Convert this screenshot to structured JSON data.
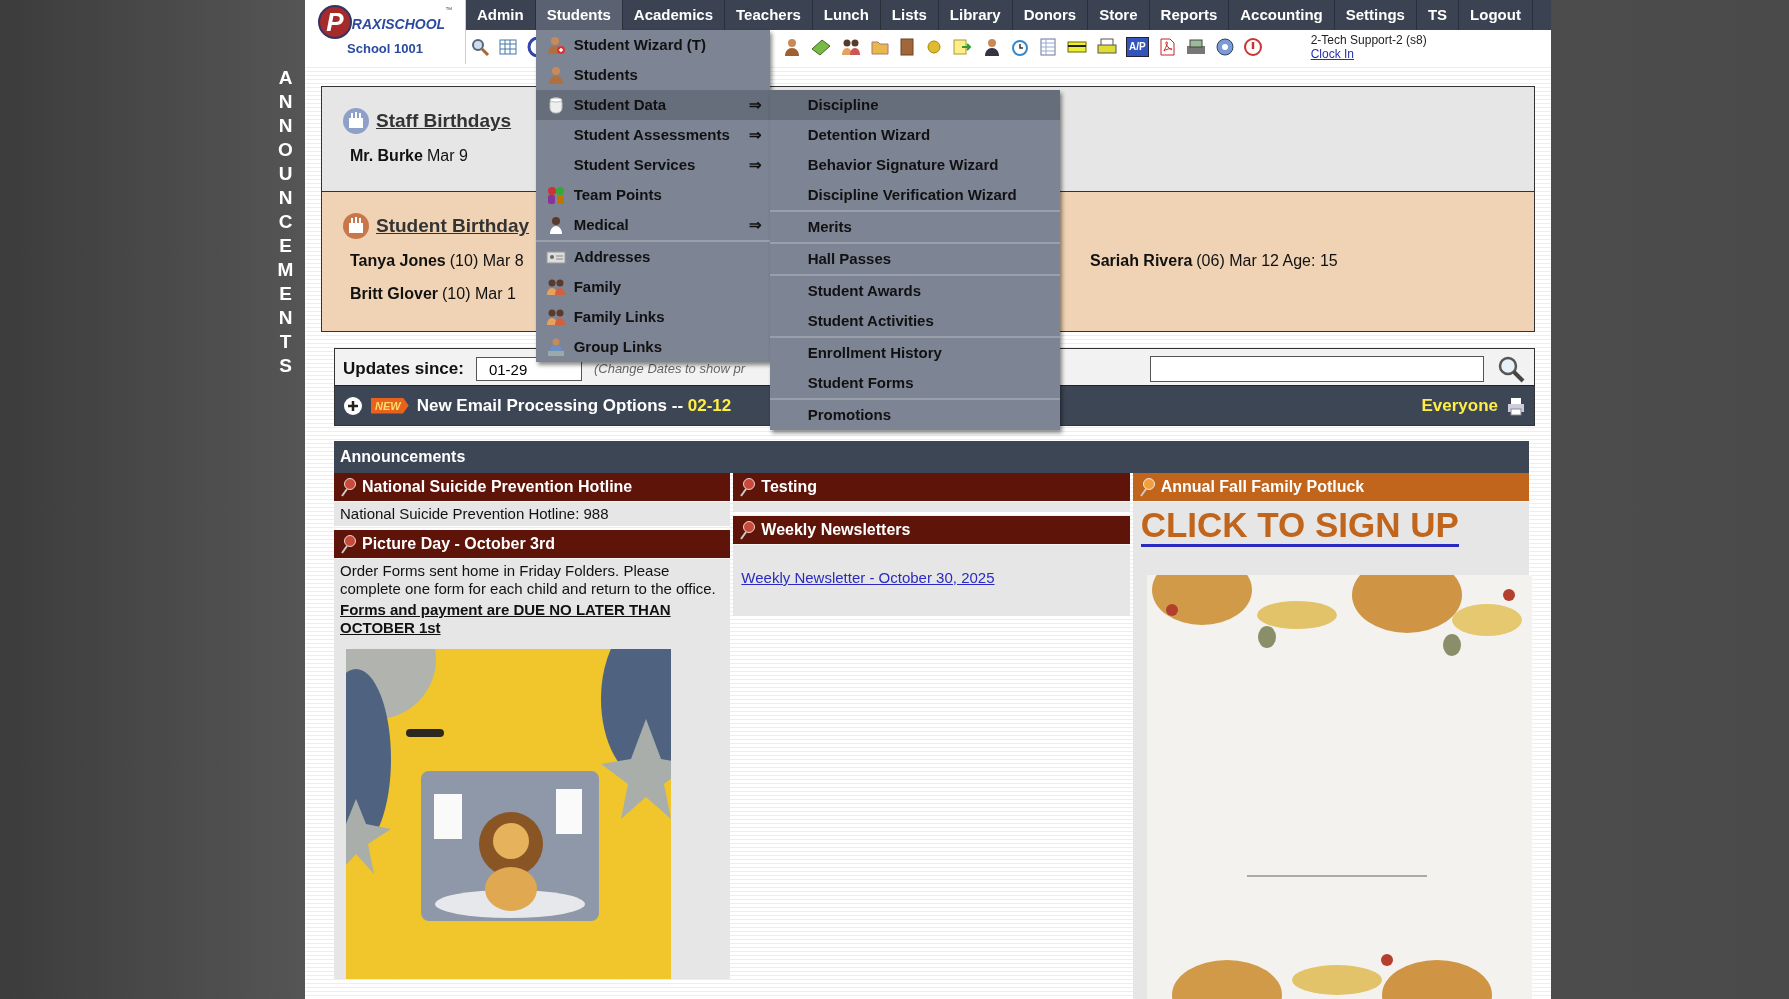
{
  "logo": {
    "initial": "P",
    "name": "RAXISCHOOL",
    "mark": "™",
    "school": "School 1001"
  },
  "nav": [
    {
      "label": "Admin",
      "selected": false
    },
    {
      "label": "Students",
      "selected": true
    },
    {
      "label": "Academics",
      "selected": false
    },
    {
      "label": "Teachers",
      "selected": false
    },
    {
      "label": "Lunch",
      "selected": false
    },
    {
      "label": "Lists",
      "selected": false
    },
    {
      "label": "Library",
      "selected": false
    },
    {
      "label": "Donors",
      "selected": false
    },
    {
      "label": "Store",
      "selected": false
    },
    {
      "label": "Reports",
      "selected": false
    },
    {
      "label": "Accounting",
      "selected": false
    },
    {
      "label": "Settings",
      "selected": false
    },
    {
      "label": "TS",
      "selected": false
    },
    {
      "label": "Logout",
      "selected": false
    }
  ],
  "user": {
    "name": "2-Tech Support-2 (s8)",
    "clock_link": "Clock In"
  },
  "toolbar": {
    "ap_label": "A/P"
  },
  "side_label": "ANNOUNCEMENTS",
  "students_menu": {
    "sections": [
      [
        {
          "label": "Student Wizard (T)",
          "selected": false
        },
        {
          "label": "Students",
          "selected": false
        },
        {
          "label": "Student Data",
          "submenu_arrow": "⇒",
          "selected": true
        },
        {
          "label": "Student Assessments",
          "submenu_arrow": "⇒",
          "selected": false
        },
        {
          "label": "Student Services",
          "submenu_arrow": "⇒",
          "selected": false
        },
        {
          "label": "Team Points",
          "selected": false
        },
        {
          "label": "Medical",
          "submenu_arrow": "⇒",
          "selected": false
        }
      ],
      [
        {
          "label": "Addresses",
          "selected": false
        },
        {
          "label": "Family",
          "selected": false
        },
        {
          "label": "Family Links",
          "selected": false
        },
        {
          "label": "Group Links",
          "selected": false
        }
      ]
    ]
  },
  "student_data_menu": {
    "sections": [
      [
        {
          "label": "Discipline",
          "selected": true
        },
        {
          "label": "Detention Wizard",
          "selected": false
        },
        {
          "label": "Behavior Signature Wizard",
          "selected": false
        },
        {
          "label": "Discipline Verification Wizard",
          "selected": false
        }
      ],
      [
        {
          "label": "Merits",
          "selected": false
        }
      ],
      [
        {
          "label": "Hall Passes",
          "selected": false
        }
      ],
      [
        {
          "label": "Student Awards",
          "selected": false
        },
        {
          "label": "Student Activities",
          "selected": false
        }
      ],
      [
        {
          "label": "Enrollment History",
          "selected": false
        },
        {
          "label": "Student Forms",
          "selected": false
        }
      ],
      [
        {
          "label": "Promotions",
          "selected": false
        }
      ]
    ]
  },
  "staff_birthdays": {
    "title": "Staff Birthdays",
    "entries": [
      {
        "name": "Mr. Burke",
        "detail": "Mar 9"
      }
    ]
  },
  "student_birthdays": {
    "title": "Student Birthday",
    "columns": [
      [
        {
          "name": "Tanya Jones",
          "detail": "(10) Mar 8"
        },
        {
          "name": "Britt Glover",
          "detail": "(10) Mar 1"
        }
      ],
      [
        {
          "name": "Sariah Rivera",
          "detail": "(06) Mar 12 Age: 15"
        }
      ]
    ]
  },
  "updates": {
    "label": "Updates since:",
    "date": "01-29",
    "hint": "(Change Dates to show pr"
  },
  "email_bar": {
    "badge": "NEW",
    "title": "New Email Processing Options -- ",
    "date": "02-12",
    "audience": "Everyone"
  },
  "announcements": {
    "title": "Announcements",
    "columns": [
      [
        {
          "title": "National Suicide Prevention Hotline",
          "color": "#5e1408",
          "body": [
            {
              "kind": "text",
              "text": "National Suicide Prevention Hotline: 988"
            }
          ]
        },
        {
          "title": "Picture Day - October 3rd",
          "color": "#5e1408",
          "body": [
            {
              "kind": "text",
              "text": "Order Forms sent home in Friday Folders. Please complete one form for each child and return to the office."
            },
            {
              "kind": "emphasis",
              "text": "Forms and payment are DUE NO LATER THAN OCTOBER 1st"
            },
            {
              "kind": "picture"
            }
          ]
        }
      ],
      [
        {
          "title": "Testing",
          "color": "#5e1408"
        },
        {
          "title": "Weekly Newsletters",
          "color": "#5e1408",
          "body": [
            {
              "kind": "link",
              "text": "Weekly Newsletter - October 30, 2025"
            }
          ]
        }
      ],
      [
        {
          "title": "Annual Fall Family Potluck",
          "color": "#c0651b",
          "body": [
            {
              "kind": "signup",
              "text": "CLICK TO SIGN UP"
            },
            {
              "kind": "picture"
            }
          ]
        }
      ]
    ]
  }
}
